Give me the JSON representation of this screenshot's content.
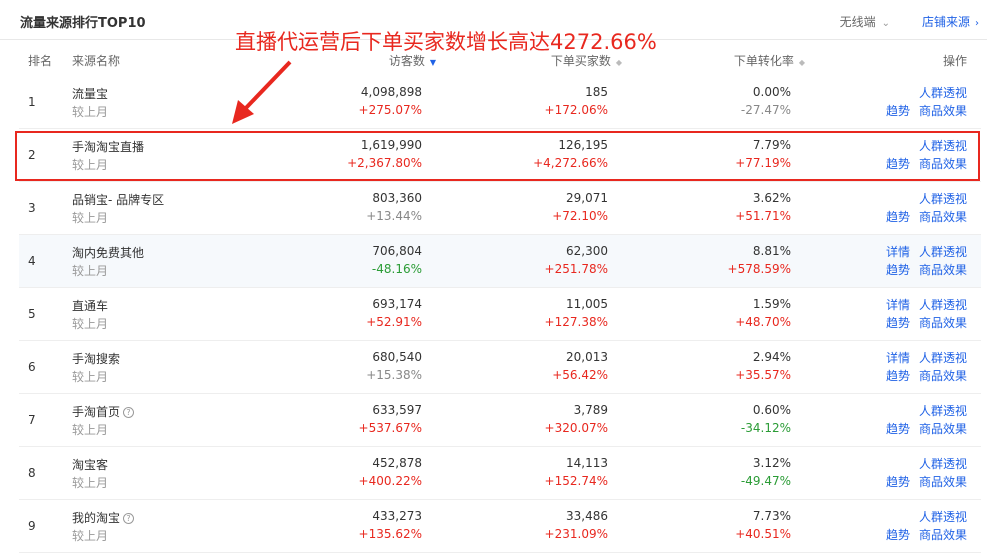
{
  "header": {
    "title": "流量来源排行TOP10",
    "device": "无线端",
    "shop_source_link": "店铺来源"
  },
  "annotation": "直播代运营后下单买家数增长高达4272.66%",
  "columns": {
    "rank": "排名",
    "source": "来源名称",
    "visitors": "访客数",
    "buyers": "下单买家数",
    "conversion": "下单转化率",
    "actions": "操作"
  },
  "compare_label": "较上月",
  "rows": [
    {
      "rank": "1",
      "name": "流量宝",
      "help": false,
      "visitors": "4,098,898",
      "visitors_change": "+275.07%",
      "buyers": "185",
      "buyers_change": "+172.06%",
      "conversion": "0.00%",
      "conversion_change": "-27.47%",
      "ops_top": [
        "人群透视"
      ],
      "ops_bottom": [
        "趋势",
        "商品效果"
      ]
    },
    {
      "rank": "2",
      "name": "手淘淘宝直播",
      "help": false,
      "visitors": "1,619,990",
      "visitors_change": "+2,367.80%",
      "buyers": "126,195",
      "buyers_change": "+4,272.66%",
      "conversion": "7.79%",
      "conversion_change": "+77.19%",
      "ops_top": [
        "人群透视"
      ],
      "ops_bottom": [
        "趋势",
        "商品效果"
      ]
    },
    {
      "rank": "3",
      "name": "品销宝- 品牌专区",
      "help": false,
      "visitors": "803,360",
      "visitors_change": "+13.44%",
      "buyers": "29,071",
      "buyers_change": "+72.10%",
      "conversion": "3.62%",
      "conversion_change": "+51.71%",
      "ops_top": [
        "人群透视"
      ],
      "ops_bottom": [
        "趋势",
        "商品效果"
      ]
    },
    {
      "rank": "4",
      "name": "淘内免费其他",
      "help": false,
      "visitors": "706,804",
      "visitors_change": "-48.16%",
      "buyers": "62,300",
      "buyers_change": "+251.78%",
      "conversion": "8.81%",
      "conversion_change": "+578.59%",
      "ops_top": [
        "详情",
        "人群透视"
      ],
      "ops_bottom": [
        "趋势",
        "商品效果"
      ]
    },
    {
      "rank": "5",
      "name": "直通车",
      "help": false,
      "visitors": "693,174",
      "visitors_change": "+52.91%",
      "buyers": "11,005",
      "buyers_change": "+127.38%",
      "conversion": "1.59%",
      "conversion_change": "+48.70%",
      "ops_top": [
        "详情",
        "人群透视"
      ],
      "ops_bottom": [
        "趋势",
        "商品效果"
      ]
    },
    {
      "rank": "6",
      "name": "手淘搜索",
      "help": false,
      "visitors": "680,540",
      "visitors_change": "+15.38%",
      "buyers": "20,013",
      "buyers_change": "+56.42%",
      "conversion": "2.94%",
      "conversion_change": "+35.57%",
      "ops_top": [
        "详情",
        "人群透视"
      ],
      "ops_bottom": [
        "趋势",
        "商品效果"
      ]
    },
    {
      "rank": "7",
      "name": "手淘首页",
      "help": true,
      "visitors": "633,597",
      "visitors_change": "+537.67%",
      "buyers": "3,789",
      "buyers_change": "+320.07%",
      "conversion": "0.60%",
      "conversion_change": "-34.12%",
      "ops_top": [
        "人群透视"
      ],
      "ops_bottom": [
        "趋势",
        "商品效果"
      ]
    },
    {
      "rank": "8",
      "name": "淘宝客",
      "help": false,
      "visitors": "452,878",
      "visitors_change": "+400.22%",
      "buyers": "14,113",
      "buyers_change": "+152.74%",
      "conversion": "3.12%",
      "conversion_change": "-49.47%",
      "ops_top": [
        "人群透视"
      ],
      "ops_bottom": [
        "趋势",
        "商品效果"
      ]
    },
    {
      "rank": "9",
      "name": "我的淘宝",
      "help": true,
      "visitors": "433,273",
      "visitors_change": "+135.62%",
      "buyers": "33,486",
      "buyers_change": "+231.09%",
      "conversion": "7.73%",
      "conversion_change": "+40.51%",
      "ops_top": [
        "人群透视"
      ],
      "ops_bottom": [
        "趋势",
        "商品效果"
      ]
    }
  ],
  "colors": {
    "up": "#e8281f",
    "down": "#2b9c36",
    "link": "#2062e6",
    "annotation": "#e8281f"
  }
}
